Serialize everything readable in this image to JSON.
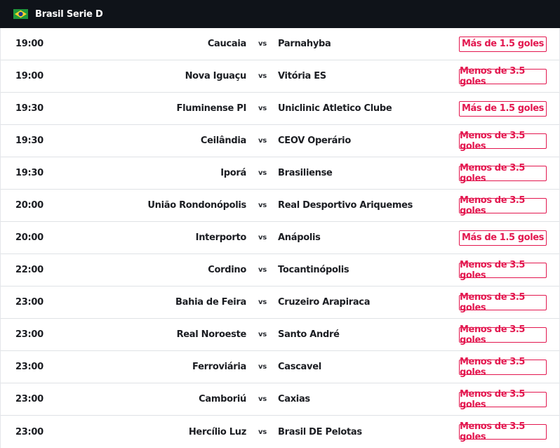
{
  "league": {
    "name": "Brasil Serie D",
    "flag_icon": "brazil-flag-icon",
    "colors": {
      "header_bg": "#0f1319",
      "accent": "#e3174f"
    }
  },
  "vs_label": "vs",
  "matches": [
    {
      "time": "19:00",
      "home": "Caucaia",
      "away": "Parnahyba",
      "tip": "Más de 1.5 goles"
    },
    {
      "time": "19:00",
      "home": "Nova Iguaçu",
      "away": "Vitória ES",
      "tip": "Menos de 3.5 goles"
    },
    {
      "time": "19:30",
      "home": "Fluminense PI",
      "away": "Uniclinic Atletico Clube",
      "tip": "Más de 1.5 goles"
    },
    {
      "time": "19:30",
      "home": "Ceilândia",
      "away": "CEOV Operário",
      "tip": "Menos de 3.5 goles"
    },
    {
      "time": "19:30",
      "home": "Iporá",
      "away": "Brasiliense",
      "tip": "Menos de 3.5 goles"
    },
    {
      "time": "20:00",
      "home": "União Rondonópolis",
      "away": "Real Desportivo Ariquemes",
      "tip": "Menos de 3.5 goles"
    },
    {
      "time": "20:00",
      "home": "Interporto",
      "away": "Anápolis",
      "tip": "Más de 1.5 goles"
    },
    {
      "time": "22:00",
      "home": "Cordino",
      "away": "Tocantinópolis",
      "tip": "Menos de 3.5 goles"
    },
    {
      "time": "23:00",
      "home": "Bahia de Feira",
      "away": "Cruzeiro Arapiraca",
      "tip": "Menos de 3.5 goles"
    },
    {
      "time": "23:00",
      "home": "Real Noroeste",
      "away": "Santo André",
      "tip": "Menos de 3.5 goles"
    },
    {
      "time": "23:00",
      "home": "Ferroviária",
      "away": "Cascavel",
      "tip": "Menos de 3.5 goles"
    },
    {
      "time": "23:00",
      "home": "Camboriú",
      "away": "Caxias",
      "tip": "Menos de 3.5 goles"
    },
    {
      "time": "23:00",
      "home": "Hercílio Luz",
      "away": "Brasil DE Pelotas",
      "tip": "Menos de 3.5 goles"
    }
  ]
}
